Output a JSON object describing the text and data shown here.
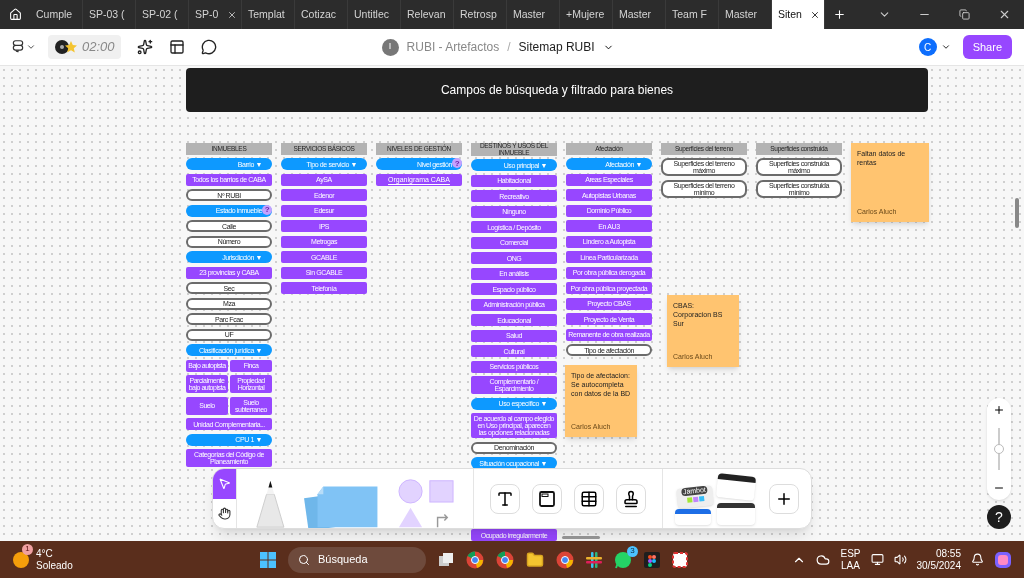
{
  "browser_tabs": [
    {
      "label": "Cumple",
      "selected": false,
      "closable": false
    },
    {
      "label": "SP-03 (",
      "selected": false,
      "closable": false
    },
    {
      "label": "SP-02 (",
      "selected": false,
      "closable": false
    },
    {
      "label": "SP-0",
      "selected": false,
      "closable": true
    },
    {
      "label": "Templat",
      "selected": false,
      "closable": false
    },
    {
      "label": "Cotizac",
      "selected": false,
      "closable": false
    },
    {
      "label": "Untitlec",
      "selected": false,
      "closable": false
    },
    {
      "label": "Relevan",
      "selected": false,
      "closable": false
    },
    {
      "label": "Retrosp",
      "selected": false,
      "closable": false
    },
    {
      "label": "Master",
      "selected": false,
      "closable": false
    },
    {
      "label": "+Mujere",
      "selected": false,
      "closable": false
    },
    {
      "label": "Master",
      "selected": false,
      "closable": false
    },
    {
      "label": "Team F",
      "selected": false,
      "closable": false
    },
    {
      "label": "Master",
      "selected": false,
      "closable": false
    },
    {
      "label": "Siten",
      "selected": true,
      "closable": true
    }
  ],
  "toolbar": {
    "timer": "02:00",
    "team_initial": "I",
    "project": "RUBI - Artefactos",
    "separator": "/",
    "file": "Sitemap RUBI",
    "user_initial": "C",
    "share": "Share"
  },
  "canvas": {
    "title": "Campos de búsqueda y filtrado para bienes",
    "columns": [
      {
        "header": "INMUEBLES",
        "items": [
          {
            "kind": "filter",
            "label": "Barrio ▼"
          },
          {
            "kind": "option",
            "label": "Todos los barrios de CABA"
          },
          {
            "kind": "field",
            "label": "Nº RUBI"
          },
          {
            "kind": "filter",
            "label": "Estado inmueble",
            "badge": "?"
          },
          {
            "kind": "field",
            "label": "Calle"
          },
          {
            "kind": "field",
            "label": "Número"
          },
          {
            "kind": "filter",
            "label": "Jurisdicción ▼"
          },
          {
            "kind": "option",
            "label": "23 provincias y CABA"
          },
          {
            "kind": "field",
            "label": "Sec"
          },
          {
            "kind": "field",
            "label": "Mza"
          },
          {
            "kind": "field",
            "label": "Parc Fcac"
          },
          {
            "kind": "field",
            "label": "UF"
          },
          {
            "kind": "filter",
            "label": "Clasificación jurídica ▼"
          },
          {
            "kind": "pair",
            "items": [
              {
                "label": "Bajo autopista"
              },
              {
                "label": "Finca"
              }
            ]
          },
          {
            "kind": "pair",
            "items": [
              {
                "label": "Parcialmente bajo autopista"
              },
              {
                "label": "Propiedad Horizontal"
              }
            ]
          },
          {
            "kind": "pair",
            "items": [
              {
                "label": "Suelo"
              },
              {
                "label": "Suelo subterraneo"
              }
            ]
          },
          {
            "kind": "option",
            "label": "Unidad Complementaria..."
          },
          {
            "kind": "filter",
            "label": "CPU 1 ▼"
          },
          {
            "kind": "option",
            "label": "Categorías del Código de Planeamiento"
          }
        ]
      },
      {
        "header": "SERVICIOS BÁSICOS",
        "items": [
          {
            "kind": "filter",
            "label": "Tipo de servicio ▼"
          },
          {
            "kind": "option",
            "label": "AySA"
          },
          {
            "kind": "option",
            "label": "Edenor"
          },
          {
            "kind": "option",
            "label": "Edesur"
          },
          {
            "kind": "option",
            "label": "IPS"
          },
          {
            "kind": "option",
            "label": "Metrogas"
          },
          {
            "kind": "option",
            "label": "GCABLE"
          },
          {
            "kind": "option",
            "label": "Sin GCABLE"
          },
          {
            "kind": "option",
            "label": "Telefonía"
          }
        ]
      },
      {
        "header": "NIVELES DE GESTIÓN",
        "items": [
          {
            "kind": "filter",
            "label": "Nivel gestión",
            "badge": "?"
          },
          {
            "kind": "link",
            "label": "Organigrama CABA"
          }
        ]
      },
      {
        "header": "DESTINOS Y USOS DEL INMUEBLE",
        "items": [
          {
            "kind": "filter",
            "label": "Uso principal ▼"
          },
          {
            "kind": "option",
            "label": "Habitacional"
          },
          {
            "kind": "option",
            "label": "Recreativo"
          },
          {
            "kind": "option",
            "label": "Ninguno"
          },
          {
            "kind": "option",
            "label": "Logística / Depósito"
          },
          {
            "kind": "option",
            "label": "Comercial"
          },
          {
            "kind": "option",
            "label": "ONG"
          },
          {
            "kind": "option",
            "label": "En análisis"
          },
          {
            "kind": "option",
            "label": "Espacio público"
          },
          {
            "kind": "option",
            "label": "Administración pública"
          },
          {
            "kind": "option",
            "label": "Educacional"
          },
          {
            "kind": "option",
            "label": "Salud"
          },
          {
            "kind": "option",
            "label": "Cultural"
          },
          {
            "kind": "option",
            "label": "Servicios públicos"
          },
          {
            "kind": "option",
            "label": "Complementario / Esparcimiento"
          },
          {
            "kind": "filter",
            "label": "Uso específico ▼"
          },
          {
            "kind": "option",
            "label": "De acuerdo al campo elegido en Uso principal, aparecen las opciones relacionadas"
          },
          {
            "kind": "field",
            "label": "Denominación"
          },
          {
            "kind": "filter",
            "label": "Situación ocupacional ▼"
          }
        ],
        "trailing_item": {
          "kind": "option",
          "label": "Ocupado irregularmente"
        }
      },
      {
        "header": "Afectación",
        "items": [
          {
            "kind": "filter",
            "label": "Afectación ▼"
          },
          {
            "kind": "option",
            "label": "Areas Especiales"
          },
          {
            "kind": "option",
            "label": "Autopistas Urbanas"
          },
          {
            "kind": "option",
            "label": "Dominio Público"
          },
          {
            "kind": "option",
            "label": "En AU3"
          },
          {
            "kind": "option",
            "label": "Lindero a Autopista"
          },
          {
            "kind": "option",
            "label": "Línea Particularizada"
          },
          {
            "kind": "option",
            "label": "Por obra pública derogada"
          },
          {
            "kind": "option",
            "label": "Por obra pública proyectada"
          },
          {
            "kind": "option",
            "label": "Proyecto CBAS"
          },
          {
            "kind": "option",
            "label": "Proyecto de Venta"
          },
          {
            "kind": "option",
            "label": "Remanente de obra realizada"
          },
          {
            "kind": "field",
            "label": "Tipo de afectación"
          }
        ]
      },
      {
        "header": "Superficies del terreno",
        "items": [
          {
            "kind": "field",
            "label": "Superficies del terreno máximo"
          },
          {
            "kind": "field",
            "label": "Superficies del terreno mínimo"
          }
        ]
      },
      {
        "header": "Superficies construida",
        "items": [
          {
            "kind": "field",
            "label": "Superficies construida máximo"
          },
          {
            "kind": "field",
            "label": "Superficies construida mínimo"
          }
        ]
      }
    ],
    "column_note": {
      "text": "Faltan datos de rentas",
      "author": "Carlos Aluch"
    },
    "sticky_notes": [
      {
        "text": "CBAS: Corporacion BS Sur",
        "author": "Carlos Aluch"
      },
      {
        "text": "Tipo de afectacion: Se autocompleta con datos de la BD",
        "author": "Carlos Aluch"
      }
    ]
  },
  "creation_toolbar": {
    "template_label": "Jambot"
  },
  "zoom": {
    "level": 0.5
  },
  "help": "?",
  "taskbar": {
    "weather_badge": "1",
    "temperature": "4°C",
    "condition": "Soleado",
    "search_placeholder": "Búsqueda",
    "whatsapp_badge": "3",
    "language": "ESP",
    "layout": "LAA",
    "time": "08:55",
    "date": "30/5/2024"
  }
}
